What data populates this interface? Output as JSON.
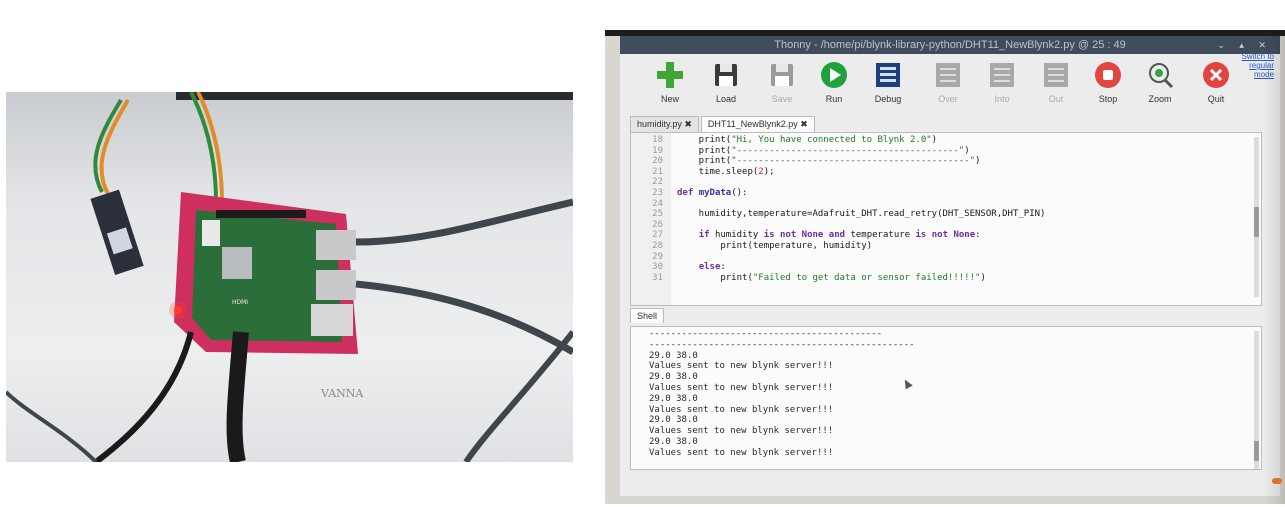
{
  "photo": {
    "board_label": "HDMI",
    "desk_writing": "VANNA"
  },
  "thonny": {
    "title": "Thonny  -  /home/pi/blynk-library-python/DHT11_NewBlynk2.py  @  25 : 49",
    "toolbar": [
      {
        "id": "new",
        "label": "New",
        "enabled": true,
        "icon": "plus-icon",
        "color": "#3fa535"
      },
      {
        "id": "load",
        "label": "Load",
        "enabled": true,
        "icon": "floppy-load-icon",
        "color": "#3a3a3a"
      },
      {
        "id": "save",
        "label": "Save",
        "enabled": false,
        "icon": "floppy-save-icon",
        "color": "#9a9a9a"
      },
      {
        "id": "run",
        "label": "Run",
        "enabled": true,
        "icon": "play-icon",
        "color": "#20a23a"
      },
      {
        "id": "debug",
        "label": "Debug",
        "enabled": true,
        "icon": "debug-icon",
        "color": "#1e3f78"
      },
      {
        "id": "over",
        "label": "Over",
        "enabled": false,
        "icon": "step-over-icon",
        "color": "#a8a8a8"
      },
      {
        "id": "into",
        "label": "Into",
        "enabled": false,
        "icon": "step-into-icon",
        "color": "#a8a8a8"
      },
      {
        "id": "out",
        "label": "Out",
        "enabled": false,
        "icon": "step-out-icon",
        "color": "#a8a8a8"
      },
      {
        "id": "stop",
        "label": "Stop",
        "enabled": true,
        "icon": "stop-icon",
        "color": "#e0453f"
      },
      {
        "id": "zoom",
        "label": "Zoom",
        "enabled": true,
        "icon": "zoom-icon",
        "color": "#3aa04a"
      },
      {
        "id": "quit",
        "label": "Quit",
        "enabled": true,
        "icon": "quit-icon",
        "color": "#e0453f"
      }
    ],
    "switch_mode": "Switch to regular mode",
    "tabs": [
      "humidity.py ✖",
      "DHT11_NewBlynk2.py ✖"
    ],
    "editor_lines": [
      {
        "n": "18",
        "code": "    print(\"Hi, You have connected to Blynk 2.0\")"
      },
      {
        "n": "19",
        "code": "    print(\"-----------------------------------------\")"
      },
      {
        "n": "20",
        "code": "    print(\"-------------------------------------------\")"
      },
      {
        "n": "21",
        "code": "    time.sleep(2);"
      },
      {
        "n": "22",
        "code": ""
      },
      {
        "n": "23",
        "code": "def myData():"
      },
      {
        "n": "24",
        "code": ""
      },
      {
        "n": "25",
        "code": "    humidity,temperature=Adafruit_DHT.read_retry(DHT_SENSOR,DHT_PIN)"
      },
      {
        "n": "26",
        "code": ""
      },
      {
        "n": "27",
        "code": "    if humidity is not None and temperature is not None:"
      },
      {
        "n": "28",
        "code": "        print(temperature, humidity)"
      },
      {
        "n": "29",
        "code": ""
      },
      {
        "n": "30",
        "code": "    else:"
      },
      {
        "n": "31",
        "code": "        print(\"Failed to get data or sensor failed!!!!!\")"
      }
    ],
    "shell_tab": "Shell",
    "shell_lines": [
      "-------------------------------------------",
      "-------------------------------------------------",
      "29.0 38.0",
      "Values sent to new blynk server!!!",
      "29.0 38.0",
      "Values sent to new blynk server!!!",
      "29.0 38.0",
      "Values sent to new blynk server!!!",
      "29.0 38.0",
      "Values sent to new blynk server!!!",
      "29.0 38.0",
      "Values sent to new blynk server!!!"
    ]
  }
}
